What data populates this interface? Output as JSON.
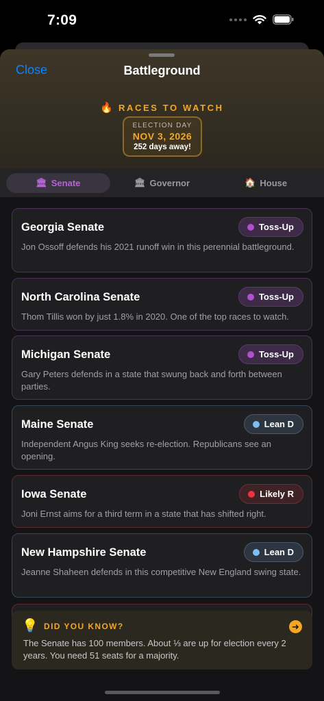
{
  "status": {
    "time": "7:09"
  },
  "header": {
    "close_label": "Close",
    "title": "Battleground",
    "watch_icon": "flame-icon",
    "watch_label": "RACES TO WATCH",
    "election_day_label": "ELECTION DAY",
    "election_date": "NOV 3, 2026",
    "days_away": "252 days away!"
  },
  "tabs": [
    {
      "label": "Senate",
      "icon": "🏛",
      "active": true
    },
    {
      "label": "Governor",
      "icon": "🏛",
      "active": false
    },
    {
      "label": "House",
      "icon": "🏠",
      "active": false
    }
  ],
  "races": [
    {
      "title": "Georgia Senate",
      "rating": "Toss-Up",
      "desc": "Jon Ossoff defends his 2021 runoff win in this perennial battleground."
    },
    {
      "title": "North Carolina Senate",
      "rating": "Toss-Up",
      "desc": "Thom Tillis won by just 1.8% in 2020. One of the top races to watch."
    },
    {
      "title": "Michigan Senate",
      "rating": "Toss-Up",
      "desc": "Gary Peters defends in a state that swung back and forth between parties."
    },
    {
      "title": "Maine Senate",
      "rating": "Lean D",
      "desc": "Independent Angus King seeks re-election. Republicans see an opening."
    },
    {
      "title": "Iowa Senate",
      "rating": "Likely R",
      "desc": "Joni Ernst aims for a third term in a state that has shifted right."
    },
    {
      "title": "New Hampshire Senate",
      "rating": "Lean D",
      "desc": "Jeanne Shaheen defends in this competitive New England swing state."
    }
  ],
  "colors": {
    "accent_blue": "#0a84ff",
    "gold": "#f5a623",
    "tossup": "#b04fd0",
    "lean_d": "#7dbff5",
    "likely_r": "#ee3340"
  },
  "tip": {
    "title": "DID YOU KNOW?",
    "text": "The Senate has 100 members. About ⅓ are up for election every 2 years. You need 51 seats for a majority."
  }
}
